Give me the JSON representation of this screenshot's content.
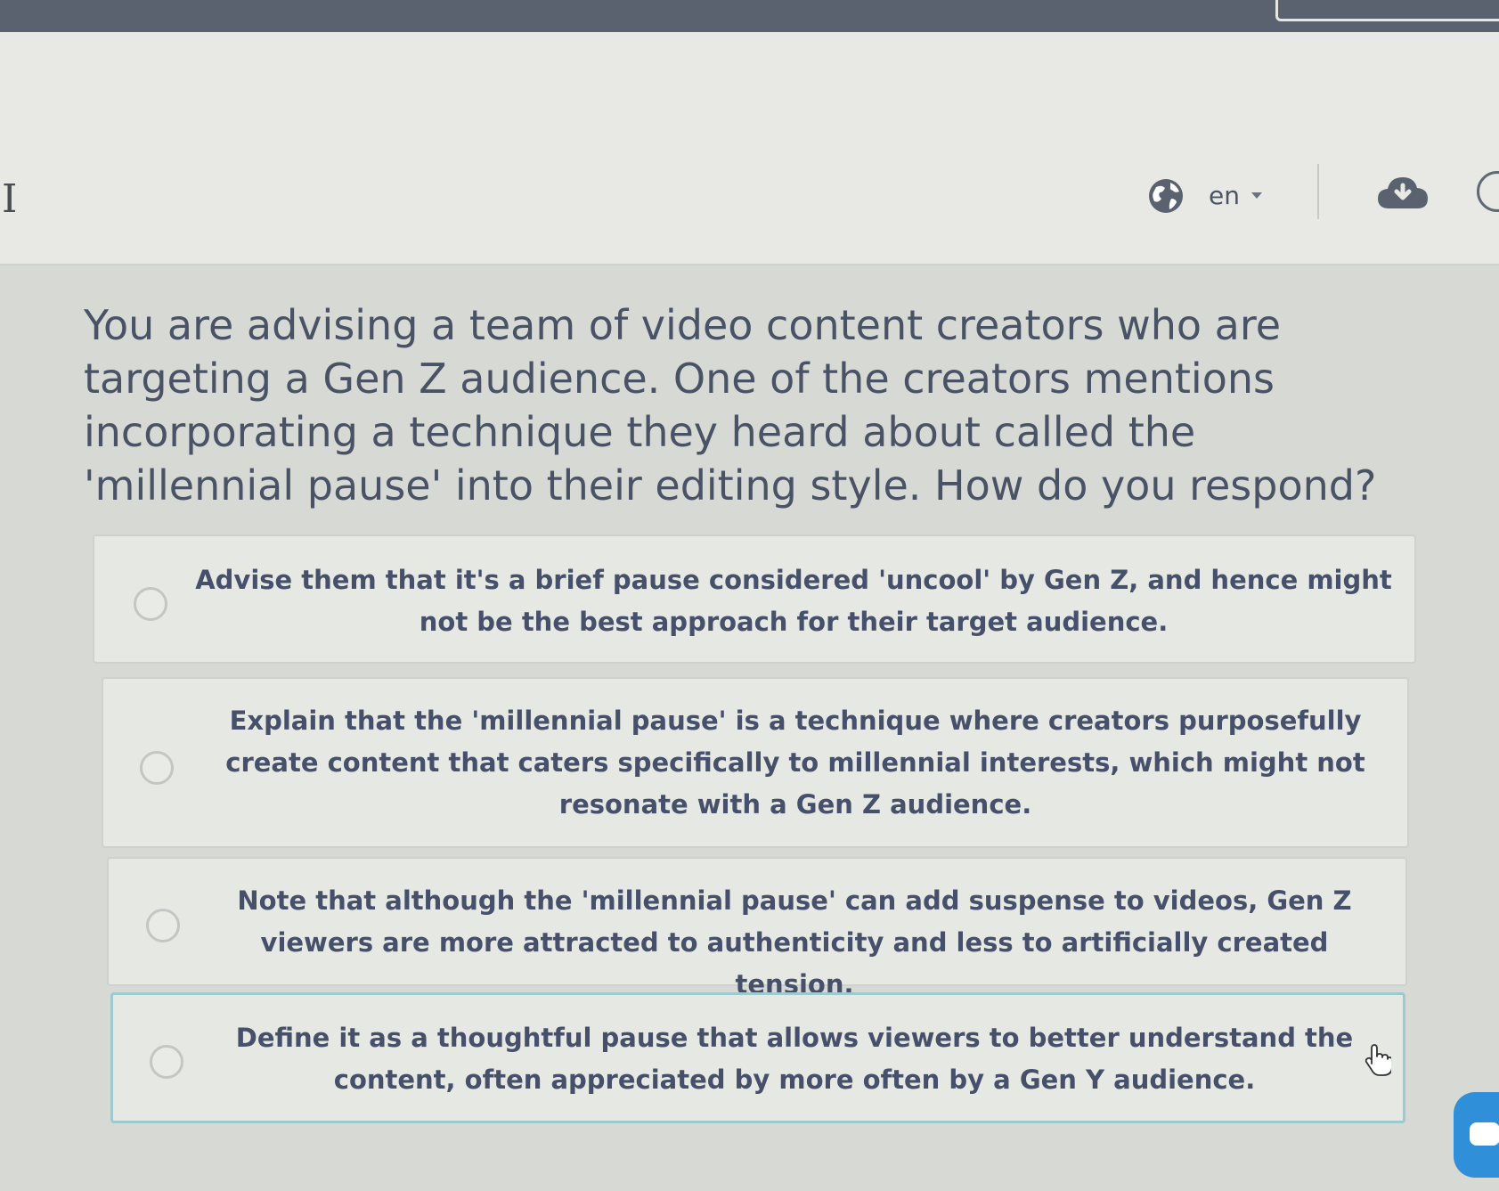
{
  "header": {
    "language": "en",
    "icons": [
      "globe-icon",
      "chevron-down-icon",
      "cloud-download-icon",
      "chat-icon",
      "hand-pointer-icon"
    ]
  },
  "question": {
    "text": "You are advising a team of video content creators who are targeting a Gen Z audience. One of the creators mentions incorporating a technique they heard about called the 'millennial pause' into their editing style. How do you respond?"
  },
  "options": [
    {
      "text": "Advise them that it's a brief pause considered 'uncool' by Gen Z, and hence might not be the best approach for their target audience."
    },
    {
      "text": "Explain that the 'millennial pause' is a technique where creators purposefully create content that caters specifically to millennial interests, which might not resonate with a Gen Z audience."
    },
    {
      "text": "Note that although the 'millennial pause' can add suspense to videos, Gen Z viewers are more attracted to authenticity and less to artificially created tension."
    },
    {
      "text": "Define it as a thoughtful pause that allows viewers to better understand the content, often appreciated by more often by a Gen Y audience."
    }
  ],
  "colors": {
    "accent": "#2f8fd8",
    "hover_border": "#9ec9ce",
    "text": "#46506a"
  }
}
